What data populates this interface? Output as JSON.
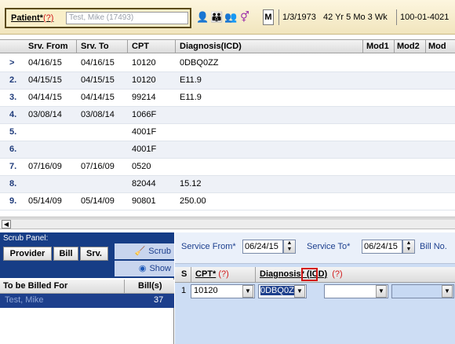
{
  "patient": {
    "label": "Patient*",
    "required_mark": "(?)",
    "name_value": "Test, Mike (17493)",
    "icons": [
      "person-icon",
      "family-icon",
      "people-icon",
      "gender-icon"
    ],
    "sex": "M",
    "dob": "1/3/1973",
    "age": "42 Yr 5 Mo 3 Wk",
    "account": "100-01-4021"
  },
  "grid": {
    "columns": [
      "Srv. From",
      "Srv. To",
      "CPT",
      "Diagnosis(ICD)",
      "Mod1",
      "Mod2",
      "Mod"
    ],
    "rows": [
      {
        "num": ">",
        "from": "04/16/15",
        "to": "04/16/15",
        "cpt": "10120",
        "dx": "0DBQ0ZZ"
      },
      {
        "num": "2.",
        "from": "04/15/15",
        "to": "04/15/15",
        "cpt": "10120",
        "dx": "E11.9"
      },
      {
        "num": "3.",
        "from": "04/14/15",
        "to": "04/14/15",
        "cpt": "99214",
        "dx": "E11.9"
      },
      {
        "num": "4.",
        "from": "03/08/14",
        "to": "03/08/14",
        "cpt": "1066F",
        "dx": ""
      },
      {
        "num": "5.",
        "from": "",
        "to": "",
        "cpt": "4001F",
        "dx": ""
      },
      {
        "num": "6.",
        "from": "",
        "to": "",
        "cpt": "4001F",
        "dx": ""
      },
      {
        "num": "7.",
        "from": "07/16/09",
        "to": "07/16/09",
        "cpt": "0520",
        "dx": ""
      },
      {
        "num": "8.",
        "from": "",
        "to": "",
        "cpt": "82044",
        "dx": "15.12"
      },
      {
        "num": "9.",
        "from": "05/14/09",
        "to": "05/14/09",
        "cpt": "90801",
        "dx": "250.00"
      }
    ]
  },
  "scrub": {
    "title": "Scrub Panel:",
    "buttons": [
      "Provider",
      "Bill",
      "Srv."
    ],
    "scrub_label": "Scrub",
    "show_label": "Show",
    "table_headers": [
      "To be Billed For",
      "Bill(s)"
    ],
    "billed_name": "Test, Mike",
    "billed_count": "37"
  },
  "entry": {
    "service_from_label": "Service From*",
    "service_from_value": "06/24/15",
    "service_to_label": "Service To*",
    "service_to_value": "06/24/15",
    "bill_no_label": "Bill No.",
    "headers": {
      "s": "S",
      "cpt": "CPT*",
      "cpt_q": "(?)",
      "dx": "Diagnosis* (ICD)",
      "dx_q": "(?)"
    },
    "row": {
      "s": "1",
      "cpt": "10120",
      "dx": "0DBQ0ZZ"
    }
  }
}
